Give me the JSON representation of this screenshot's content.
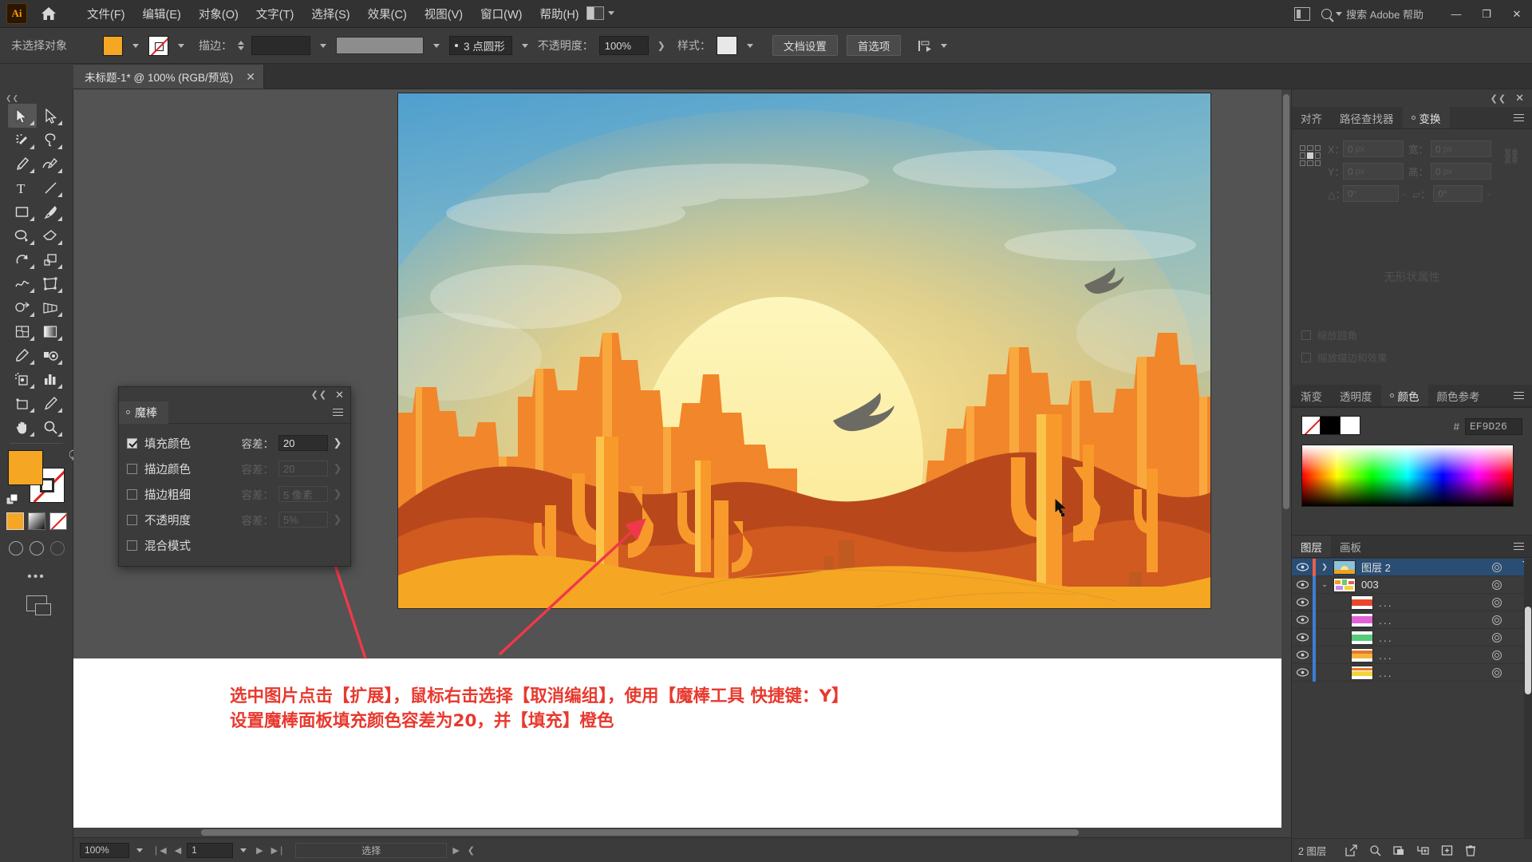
{
  "app": {
    "logo": "Ai",
    "menus": [
      "文件(F)",
      "编辑(E)",
      "对象(O)",
      "文字(T)",
      "选择(S)",
      "效果(C)",
      "视图(V)",
      "窗口(W)",
      "帮助(H)"
    ],
    "search_placeholder": "搜索 Adobe 帮助",
    "window_buttons": [
      "—",
      "❐",
      "✕"
    ]
  },
  "control_bar": {
    "selection_status": "未选择对象",
    "fill_color": "#F5A623",
    "stroke_label": "描边：",
    "stroke_weight": "",
    "brush_profile": "3 点圆形",
    "opacity_label": "不透明度：",
    "opacity_value": "100%",
    "style_label": "样式：",
    "doc_setup_button": "文档设置",
    "preferences_button": "首选项"
  },
  "document_tab": {
    "title": "未标题-1* @ 100% (RGB/预览)",
    "close": "✕"
  },
  "toolbar": {
    "tools": [
      {
        "name": "selection-tool",
        "active": true
      },
      {
        "name": "direct-selection-tool",
        "active": false
      },
      {
        "name": "magic-wand-tool",
        "active": false
      },
      {
        "name": "lasso-tool",
        "active": false
      },
      {
        "name": "pen-tool",
        "active": false
      },
      {
        "name": "curvature-tool",
        "active": false
      },
      {
        "name": "type-tool",
        "active": false
      },
      {
        "name": "line-segment-tool",
        "active": false
      },
      {
        "name": "rectangle-tool",
        "active": false
      },
      {
        "name": "paintbrush-tool",
        "active": false
      },
      {
        "name": "shaper-tool",
        "active": false
      },
      {
        "name": "eraser-tool",
        "active": false
      },
      {
        "name": "rotate-tool",
        "active": false
      },
      {
        "name": "scale-tool",
        "active": false
      },
      {
        "name": "width-tool",
        "active": false
      },
      {
        "name": "free-transform-tool",
        "active": false
      },
      {
        "name": "shape-builder-tool",
        "active": false
      },
      {
        "name": "perspective-grid-tool",
        "active": false
      },
      {
        "name": "mesh-tool",
        "active": false
      },
      {
        "name": "gradient-tool",
        "active": false
      },
      {
        "name": "eyedropper-tool",
        "active": false
      },
      {
        "name": "blend-tool",
        "active": false
      },
      {
        "name": "symbol-sprayer-tool",
        "active": false
      },
      {
        "name": "column-graph-tool",
        "active": false
      },
      {
        "name": "artboard-tool",
        "active": false
      },
      {
        "name": "slice-tool",
        "active": false
      },
      {
        "name": "hand-tool",
        "active": false
      },
      {
        "name": "zoom-tool",
        "active": false
      }
    ],
    "fill_color": "#F5A623",
    "stroke_color": "none"
  },
  "magic_wand_panel": {
    "title": "魔棒",
    "close": "✕",
    "collapse": "❮❮",
    "rows": [
      {
        "label": "填充颜色",
        "checked": true,
        "tolerance_label": "容差：",
        "tolerance_value": "20",
        "enabled": true
      },
      {
        "label": "描边颜色",
        "checked": false,
        "tolerance_label": "容差：",
        "tolerance_value": "20",
        "enabled": false
      },
      {
        "label": "描边粗细",
        "checked": false,
        "tolerance_label": "容差：",
        "tolerance_value": "5 像素",
        "enabled": false
      },
      {
        "label": "不透明度",
        "checked": false,
        "tolerance_label": "容差：",
        "tolerance_value": "5%",
        "enabled": false
      },
      {
        "label": "混合模式",
        "checked": false,
        "tolerance_label": "",
        "tolerance_value": "",
        "enabled": false
      }
    ]
  },
  "transform_panel": {
    "tabs": [
      "对齐",
      "路径查找器",
      "变换"
    ],
    "active_tab": "变换",
    "fields": {
      "x_label": "X：",
      "x_value": "0",
      "x_unit": "px",
      "y_label": "Y：",
      "y_value": "0",
      "y_unit": "px",
      "w_label": "宽：",
      "w_value": "0",
      "w_unit": "px",
      "h_label": "高：",
      "h_value": "0",
      "h_unit": "px",
      "angle_label": "△：",
      "angle_value": "0°",
      "shear_label": "▱：",
      "shear_value": "0°"
    },
    "empty_text": "无形状属性",
    "checkboxes": [
      "缩放圆角",
      "缩放描边和效果"
    ]
  },
  "color_panel": {
    "tabs": [
      "渐变",
      "透明度",
      "颜色",
      "颜色参考"
    ],
    "active_tab": "颜色",
    "hash_symbol": "#",
    "hex_value": "EF9D26"
  },
  "layers_panel": {
    "tabs": [
      "图层",
      "画板"
    ],
    "active_tab": "图层",
    "rows": [
      {
        "name": "图层 2",
        "selected": true,
        "color": "#e8604c",
        "indent": 0,
        "expand": "❯",
        "thumb_kind": "art"
      },
      {
        "name": "003",
        "selected": false,
        "color": "#3b7fd4",
        "indent": 1,
        "expand": "⌄",
        "thumb_kind": "group"
      },
      {
        "name": "...",
        "selected": false,
        "color": "#3b7fd4",
        "indent": 2,
        "expand": "",
        "thumb_kind": "red"
      },
      {
        "name": "...",
        "selected": false,
        "color": "#3b7fd4",
        "indent": 2,
        "expand": "",
        "thumb_kind": "magenta"
      },
      {
        "name": "...",
        "selected": false,
        "color": "#3b7fd4",
        "indent": 2,
        "expand": "",
        "thumb_kind": "green"
      },
      {
        "name": "...",
        "selected": false,
        "color": "#3b7fd4",
        "indent": 2,
        "expand": "",
        "thumb_kind": "orange"
      },
      {
        "name": "...",
        "selected": false,
        "color": "#3b7fd4",
        "indent": 2,
        "expand": "",
        "thumb_kind": "yellow"
      }
    ],
    "footer_count": "2 图层",
    "footer_icons": [
      "export-icon",
      "locate-icon",
      "collect-icon",
      "release-icon",
      "new-layer-icon",
      "delete-icon"
    ]
  },
  "status_bar": {
    "zoom": "100%",
    "page": "1",
    "tool_status": "选择"
  },
  "annotation": {
    "line1": "选中图片点击【扩展】，鼠标右击选择【取消编组】，使用【魔棒工具 快捷键：Y】",
    "line2": "设置魔棒面板填充颜色容差为20，并【填充】橙色",
    "color": "#E8392E"
  },
  "artwork": {
    "description": "desert-sunset-illustration",
    "sky_top": "#5DA6D0",
    "sky_mid": "#8DC3C8",
    "sun": "#FAF0A5",
    "sand": "#F5A623",
    "dune_dark": "#B8481C",
    "cactus": "#F79A2B"
  }
}
